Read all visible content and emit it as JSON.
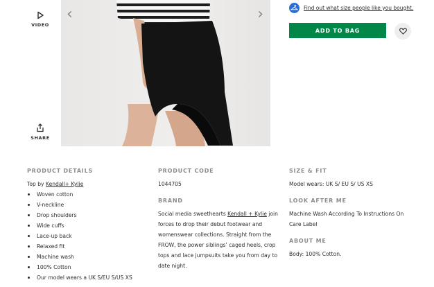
{
  "rail": {
    "video_label": "VIDEO",
    "share_label": "SHARE"
  },
  "gallery": {
    "prev_icon": "‹",
    "next_icon": "›"
  },
  "size_help": {
    "link_text": "Find out what size people like you bought.",
    "icon": "hanger-icon"
  },
  "actions": {
    "add_to_bag": "ADD TO BAG",
    "save_icon": "heart-icon"
  },
  "details": {
    "product_details": {
      "heading": "PRODUCT DETAILS",
      "line_prefix": "Top by ",
      "brand_link": "Kendall+ Kylie",
      "features": [
        "Woven cotton",
        "V-neckline",
        "Drop shoulders",
        "Wide cuffs",
        "Lace-up back",
        "Relaxed fit",
        "Machine wash",
        "100% Cotton",
        "Our model wears a UK S/EU S/US XS"
      ]
    },
    "product_code": {
      "heading": "PRODUCT CODE",
      "value": "1044705"
    },
    "brand": {
      "heading": "BRAND",
      "text_before": "Social media sweethearts ",
      "link": "Kendall + Kylie",
      "text_after": " join forces to drop their debut footwear and womenswear collections. Straight from the FROW, the power siblings’ caged heels, crop tops and lace jumpsuits take you from day to date night."
    },
    "size_fit": {
      "heading": "SIZE & FIT",
      "value": "Model wears: UK S/ EU S/ US XS"
    },
    "look_after": {
      "heading": "LOOK AFTER ME",
      "value": "Machine Wash According To Instructions On Care Label"
    },
    "about": {
      "heading": "ABOUT ME",
      "value": "Body: 100% Cotton."
    }
  }
}
